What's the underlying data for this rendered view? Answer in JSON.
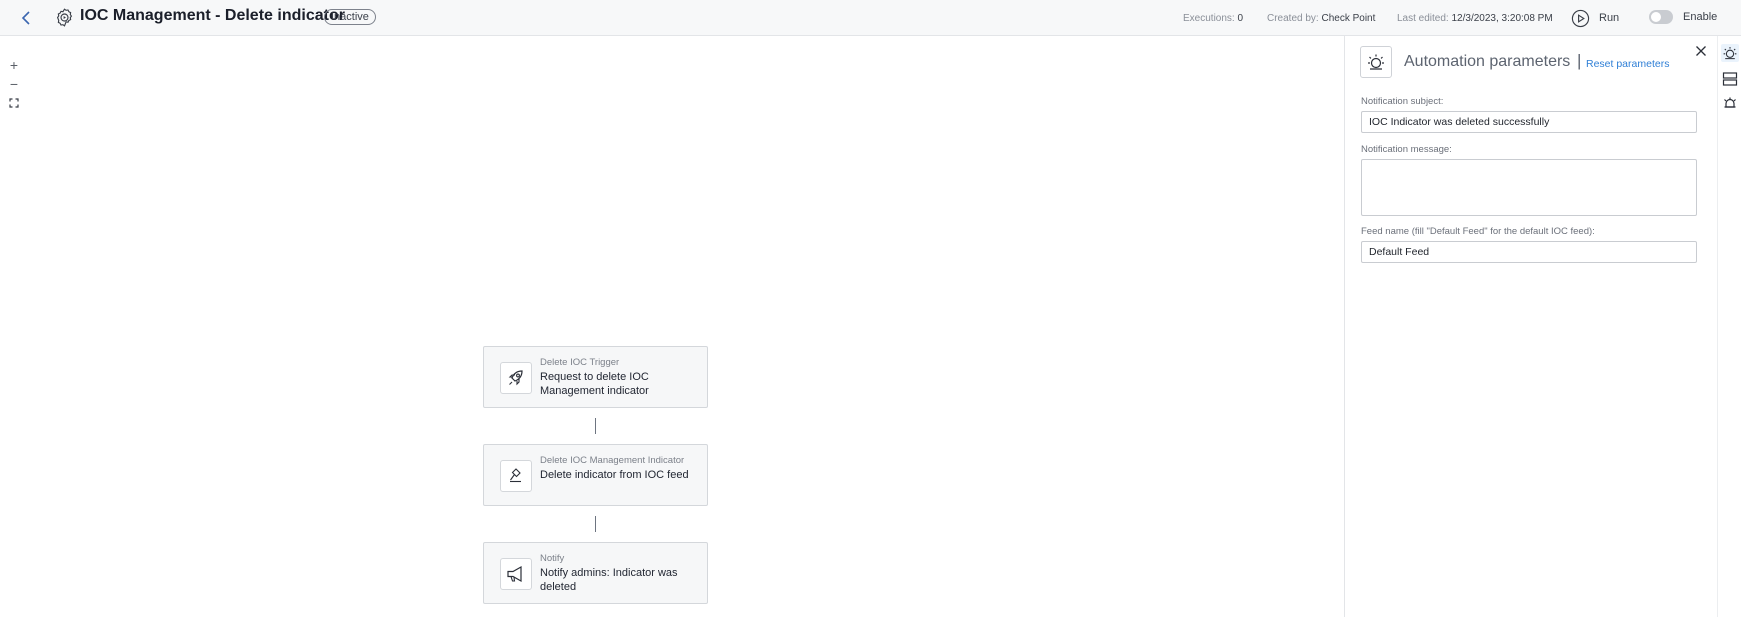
{
  "header": {
    "title": "IOC Management - Delete indicator",
    "status": "Inactive",
    "executions_label": "Executions:",
    "executions_value": "0",
    "created_by_label": "Created by:",
    "created_by_value": "Check Point",
    "last_edited_label": "Last edited:",
    "last_edited_value": "12/3/2023, 3:20:08 PM",
    "run_label": "Run",
    "enable_label": "Enable"
  },
  "zoom": {
    "in": "+",
    "out": "−"
  },
  "flow": [
    {
      "subtitle": "Delete IOC Trigger",
      "name": "Request to delete IOC Management indicator",
      "icon": "rocket-icon"
    },
    {
      "subtitle": "Delete IOC Management Indicator",
      "name": "Delete indicator from IOC feed",
      "icon": "delete-indicator-icon"
    },
    {
      "subtitle": "Notify",
      "name": "Notify admins: Indicator was deleted",
      "icon": "megaphone-icon"
    }
  ],
  "panel": {
    "title": "Automation parameters",
    "separator": "|",
    "reset": "Reset parameters",
    "subject_label": "Notification subject:",
    "subject_value": "IOC Indicator was deleted successfully",
    "message_label": "Notification message:",
    "message_value": "",
    "feed_label": "Feed name (fill \"Default Feed\" for the default IOC feed):",
    "feed_value": "Default Feed"
  },
  "colors": {
    "accent": "#2f7fd6",
    "border": "#d4d7db",
    "header_bg": "#f7f8f9"
  }
}
